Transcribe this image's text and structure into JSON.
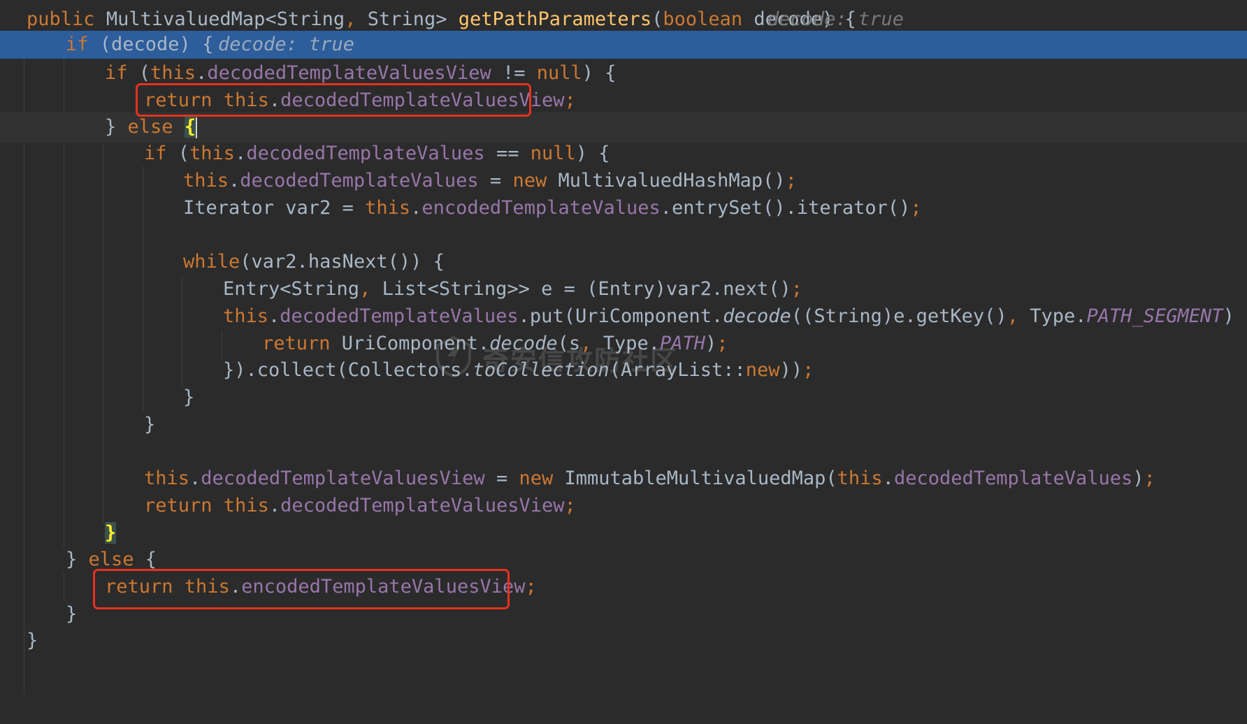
{
  "editor": {
    "line1": {
      "public": "public",
      "type": "MultivaluedMap<String",
      "comma": ",",
      "type2": " String> ",
      "method": "getPathParameters",
      "open": "(",
      "boolean": "boolean",
      "param": " decode) {",
      "inlay": "decode: true"
    },
    "line2": {
      "if": "if",
      "rest": " (decode) {",
      "inlay": "decode: true"
    },
    "line3": {
      "if": "if",
      "p1": " (",
      "this": "this",
      "dot": ".",
      "field": "decodedTemplateValuesView",
      "op": " != ",
      "null": "null",
      "end": ") {"
    },
    "line4": {
      "return": "return",
      "this": " this",
      "dot": ".",
      "field": "decodedTemplateValuesView",
      "semi": ";"
    },
    "line5": {
      "close": "} ",
      "else": "else",
      "sp": " ",
      "brace": "{"
    },
    "line6": {
      "if": "if",
      "p1": " (",
      "this": "this",
      "dot": ".",
      "field": "decodedTemplateValues",
      "op": " == ",
      "null": "null",
      "end": ") {"
    },
    "line7": {
      "this": "this",
      "dot": ".",
      "field": "decodedTemplateValues",
      "op": " = ",
      "new": "new",
      "cls": " MultivaluedHashMap()",
      "semi": ";"
    },
    "line8": {
      "cls": "Iterator var2 = ",
      "this": "this",
      "dot": ".",
      "field": "encodedTemplateValues",
      "rest": ".entrySet().iterator()",
      "semi": ";"
    },
    "line9": {
      "while": "while",
      "rest": "(var2.hasNext()) {"
    },
    "line10": {
      "a": "Entry<String",
      "comma": ",",
      "b": " List<String>> e = (Entry)var2.next()",
      "semi": ";"
    },
    "line11": {
      "this": "this",
      "dot": ".",
      "field": "decodedTemplateValues",
      "a": ".put(UriComponent.",
      "decode": "decode",
      "b": "((String)e.getKey()",
      "comma": ",",
      "c": " Type.",
      "const": "PATH_SEGMENT",
      "d": ")"
    },
    "line12": {
      "return": "return",
      "a": " UriComponent.",
      "decode": "decode",
      "b": "(s",
      "comma": ",",
      "c": " Type.",
      "const": "PATH",
      "d": ")",
      "semi": ";"
    },
    "line13": {
      "a": "}).collect(Collectors.",
      "fn": "toCollection",
      "b": "(ArrayList::",
      "new": "new",
      "c": "))",
      "semi": ";"
    },
    "line14": {
      "brace": "}"
    },
    "line15": {
      "brace": "}"
    },
    "line16": {
      "this": "this",
      "dot": ".",
      "field": "decodedTemplateValuesView",
      "op": " = ",
      "new": "new",
      "cls": " ImmutableMultivaluedMap(",
      "this2": "this",
      "dot2": ".",
      "field2": "decodedTemplateValues",
      "end": ")",
      "semi": ";"
    },
    "line17": {
      "return": "return",
      "this": " this",
      "dot": ".",
      "field": "decodedTemplateValuesView",
      "semi": ";"
    },
    "line18": {
      "brace": "}"
    },
    "line19": {
      "close": "} ",
      "else": "else",
      "rest": " {"
    },
    "line20": {
      "return": "return",
      "this": " this",
      "dot": ".",
      "field": "encodedTemplateValuesView",
      "semi": ";"
    },
    "line21": {
      "brace": "}"
    },
    "line22": {
      "brace": "}"
    }
  },
  "watermark": {
    "text": "奇安信攻防社区"
  }
}
